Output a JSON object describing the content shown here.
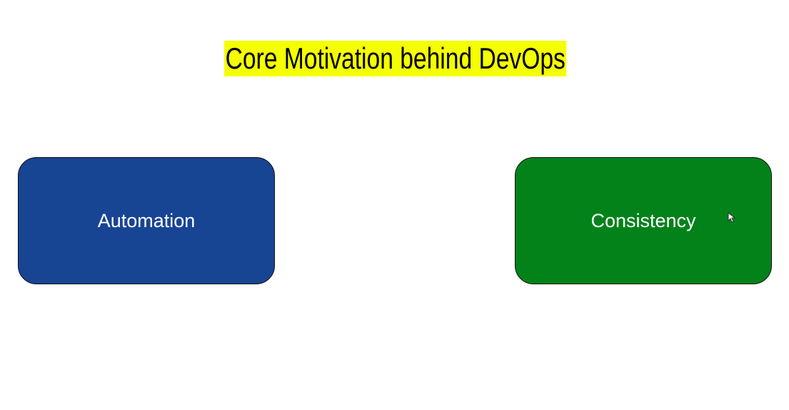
{
  "title": "Core Motivation behind DevOps",
  "boxes": [
    {
      "label": "Automation",
      "color": "#184494"
    },
    {
      "label": "Consistency",
      "color": "#04821a"
    }
  ],
  "title_highlight_color": "#f4ff00",
  "cursor_icon": "mouse-pointer-icon"
}
